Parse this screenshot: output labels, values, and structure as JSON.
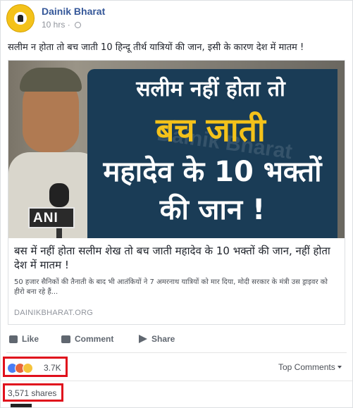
{
  "post": {
    "page_name": "Dainik Bharat",
    "time": "10 hrs",
    "privacy_icon": "globe-icon",
    "text": "सलीम न होता तो बच जाती 10 हिन्दू तीर्थ यात्रियों की जान, इसी के कारण देश में मातम !"
  },
  "image": {
    "mic_flag": "ANI",
    "watermark": "Dainik Bharat",
    "line1": "सलीम नहीं होता तो",
    "line2": "बच जाती",
    "line3": "महादेव के 10 भक्तों",
    "line4": "की जान !"
  },
  "link": {
    "title": "बस में नहीं होता सलीम शेख तो बच जाती महादेव के 10 भक्तों की जान, नहीं होता देश में मातम !",
    "description": "50 हजार सैनिकों की तैनाती के बाद भी आतंकियों ने 7 अमरनाथ यात्रियों को मार दिया, मोदी सरकार के मंत्री उस ड्राइवर को हीरो बना रहे हैं...",
    "domain": "DAINIKBHARAT.ORG"
  },
  "actions": {
    "like": "Like",
    "comment": "Comment",
    "share": "Share"
  },
  "reactions": {
    "types": [
      "like",
      "angry",
      "sad"
    ],
    "count": "3.7K",
    "colors": {
      "like": "#4a7ef5",
      "angry": "#e8663a",
      "sad": "#f5c33b"
    }
  },
  "top_comments_label": "Top Comments",
  "shares": "3,571 shares",
  "highlight_color": "#e0101c"
}
